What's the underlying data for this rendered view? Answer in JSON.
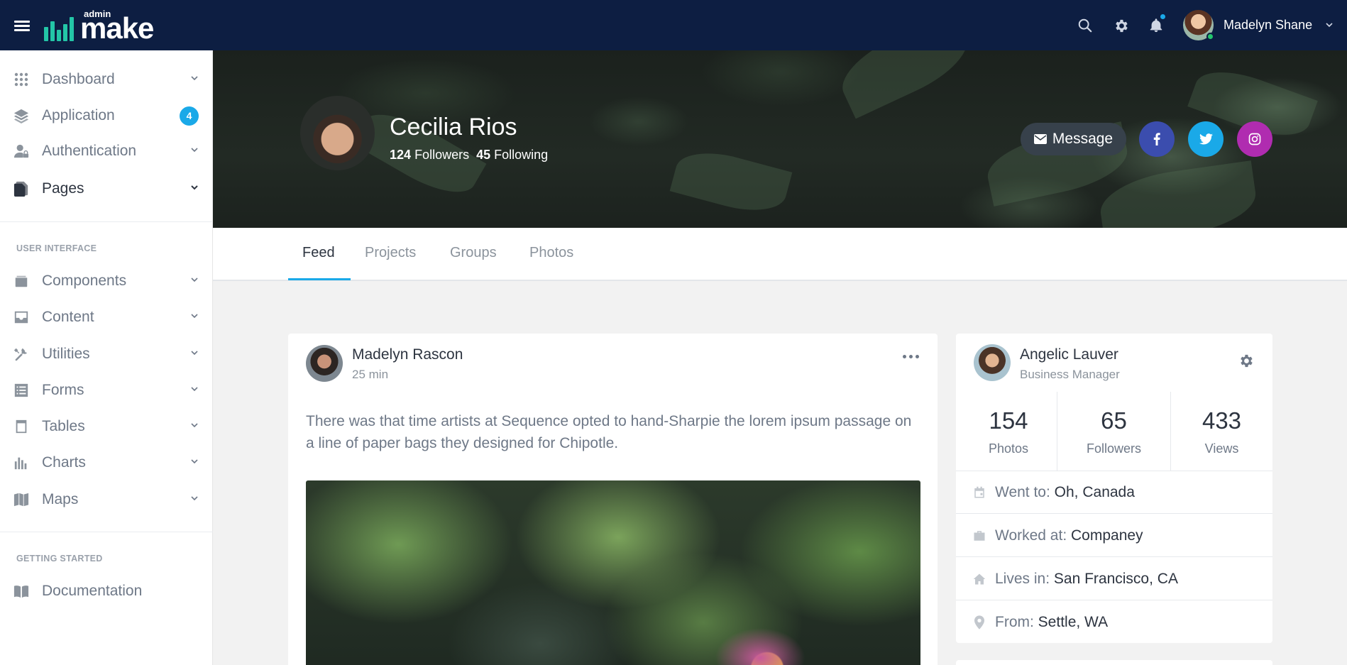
{
  "brand": {
    "small": "admin",
    "word": "make"
  },
  "topbar": {
    "user_name": "Madelyn Shane",
    "icons": [
      "search-icon",
      "gear-icon",
      "bell-icon"
    ]
  },
  "sidebar": {
    "items": [
      {
        "label": "Dashboard",
        "icon": "grid-icon"
      },
      {
        "label": "Application",
        "icon": "layers-icon",
        "badge": "4"
      },
      {
        "label": "Authentication",
        "icon": "user-lock-icon"
      },
      {
        "label": "Pages",
        "icon": "pages-icon"
      }
    ],
    "section_ui": "USER INTERFACE",
    "ui_items": [
      {
        "label": "Components",
        "icon": "wallet-icon"
      },
      {
        "label": "Content",
        "icon": "inbox-icon"
      },
      {
        "label": "Utilities",
        "icon": "tools-icon"
      },
      {
        "label": "Forms",
        "icon": "list-icon"
      },
      {
        "label": "Tables",
        "icon": "table-icon"
      },
      {
        "label": "Charts",
        "icon": "bar-chart-icon"
      },
      {
        "label": "Maps",
        "icon": "map-icon"
      }
    ],
    "section_start": "GETTING STARTED",
    "start_items": [
      {
        "label": "Documentation",
        "icon": "book-icon"
      }
    ]
  },
  "profile": {
    "name": "Cecilia Rios",
    "followers_count": "124",
    "followers_label": "Followers",
    "following_count": "45",
    "following_label": "Following",
    "message_label": "Message",
    "socials": [
      "facebook-icon",
      "twitter-icon",
      "instagram-icon"
    ]
  },
  "tabs": [
    "Feed",
    "Projects",
    "Groups",
    "Photos"
  ],
  "post": {
    "author": "Madelyn Rascon",
    "time": "25 min",
    "text": "There was that time artists at Sequence opted to hand-Sharpie the lorem ipsum passage on a line of paper bags they designed for Chipotle."
  },
  "info": {
    "name": "Angelic Lauver",
    "role": "Business Manager",
    "stats": [
      {
        "value": "154",
        "label": "Photos"
      },
      {
        "value": "65",
        "label": "Followers"
      },
      {
        "value": "433",
        "label": "Views"
      }
    ],
    "details": [
      {
        "label": "Went to:",
        "value": "Oh, Canada",
        "icon": "calendar-icon"
      },
      {
        "label": "Worked at:",
        "value": "Companey",
        "icon": "briefcase-icon"
      },
      {
        "label": "Lives in:",
        "value": "San Francisco, CA",
        "icon": "home-icon"
      },
      {
        "label": "From:",
        "value": "Settle, WA",
        "icon": "map-pin-icon"
      }
    ]
  },
  "colors": {
    "topbar": "#0d1e42",
    "accent": "#1aa9e8",
    "brand": "#23c6a7",
    "facebook": "#3b4dae",
    "twitter": "#1aa9e8",
    "instagram": "#b02cb0"
  }
}
